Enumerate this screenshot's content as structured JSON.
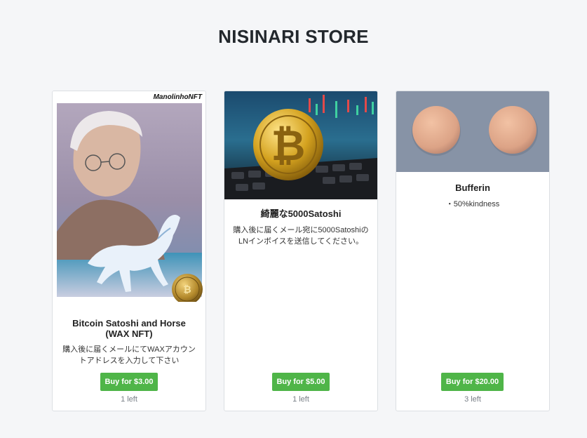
{
  "store": {
    "title": "NISINARI STORE"
  },
  "products": [
    {
      "watermark": "ManolinhoNFT",
      "name": "Bitcoin Satoshi and Horse (WAX NFT)",
      "description": "購入後に届くメールにてWAXアカウントアドレスを入力して下さい",
      "buy_label": "Buy for $3.00",
      "stock": "1 left"
    },
    {
      "coin_mark": "₿",
      "name": "綺麗な5000Satoshi",
      "description": "購入後に届くメール宛に5000SatoshiのLNインボイスを送信してください。",
      "buy_label": "Buy for $5.00",
      "stock": "1 left"
    },
    {
      "name": "Bufferin",
      "description": "・50%kindness",
      "buy_label": "Buy for $20.00",
      "stock": "3 left"
    }
  ],
  "colors": {
    "button": "#4fb548",
    "background": "#f5f6f8"
  }
}
